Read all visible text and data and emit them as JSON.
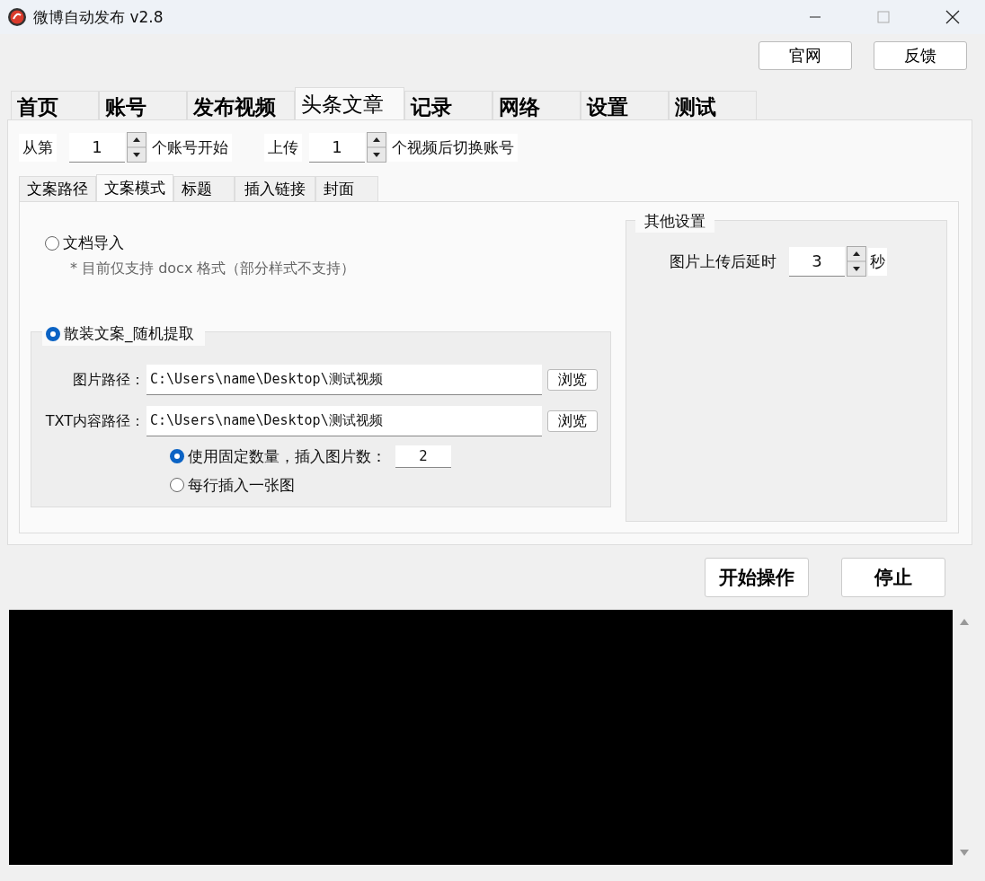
{
  "window": {
    "title": "微博自动发布  v2.8"
  },
  "header_buttons": [
    "官网",
    "反馈"
  ],
  "tabs": [
    {
      "label": "首页",
      "selected": false
    },
    {
      "label": "账号",
      "selected": false
    },
    {
      "label": "发布视频",
      "selected": false
    },
    {
      "label": "头条文章",
      "selected": true
    },
    {
      "label": "记录",
      "selected": false
    },
    {
      "label": "网络",
      "selected": false
    },
    {
      "label": "设置",
      "selected": false
    },
    {
      "label": "测试",
      "selected": false
    }
  ],
  "account_range": {
    "prefix": "从第",
    "start": "1",
    "start_suffix": "个账号开始",
    "upload_label": "上传",
    "count": "1",
    "count_suffix": "个视频后切换账号"
  },
  "subtabs": [
    {
      "label": "文案路径",
      "selected": false
    },
    {
      "label": "文案模式",
      "selected": true
    },
    {
      "label": "标题",
      "selected": false
    },
    {
      "label": "插入链接",
      "selected": false
    },
    {
      "label": "封面",
      "selected": false
    }
  ],
  "source_options": [
    {
      "label": "文档导入",
      "selected": false,
      "note": "* 目前仅支持 docx 格式（部分样式不支持）"
    },
    {
      "label": "散装文案_随机提取",
      "selected": true
    }
  ],
  "paths": [
    {
      "label": "图片路径：",
      "value": "C:\\Users\\name\\Desktop\\测试视频",
      "button": "浏览"
    },
    {
      "label": "TXT内容路径：",
      "value": "C:\\Users\\name\\Desktop\\测试视频",
      "button": "浏览"
    }
  ],
  "insert_options": [
    {
      "label": "使用固定数量，插入图片数：",
      "selected": true,
      "value": "2"
    },
    {
      "label": "每行插入一张图",
      "selected": false
    }
  ],
  "other_settings": {
    "title": "其他设置",
    "label": "图片上传后延时",
    "value": "3",
    "unit": "秒"
  },
  "actions": [
    "开始操作",
    "停止"
  ]
}
